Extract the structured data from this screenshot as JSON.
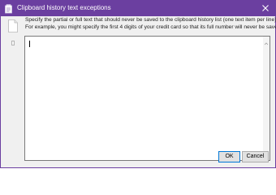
{
  "window": {
    "title": "Clipboard history text exceptions",
    "accent_color": "#6b3fa0"
  },
  "description": {
    "line1": "Specify the partial or full text that should never be saved to the clipboard history list (one text item per line).",
    "line2": "For example, you might specify the first 4 digits of your credit card so that its full number will never be saved."
  },
  "exceptions_text": {
    "value": ""
  },
  "buttons": {
    "ok_label": "OK",
    "cancel_label": "Cancel"
  },
  "icons": {
    "app": "clipboard-app-icon",
    "close": "close-icon",
    "document": "document-icon",
    "ruler": "text-cursor-icon"
  }
}
